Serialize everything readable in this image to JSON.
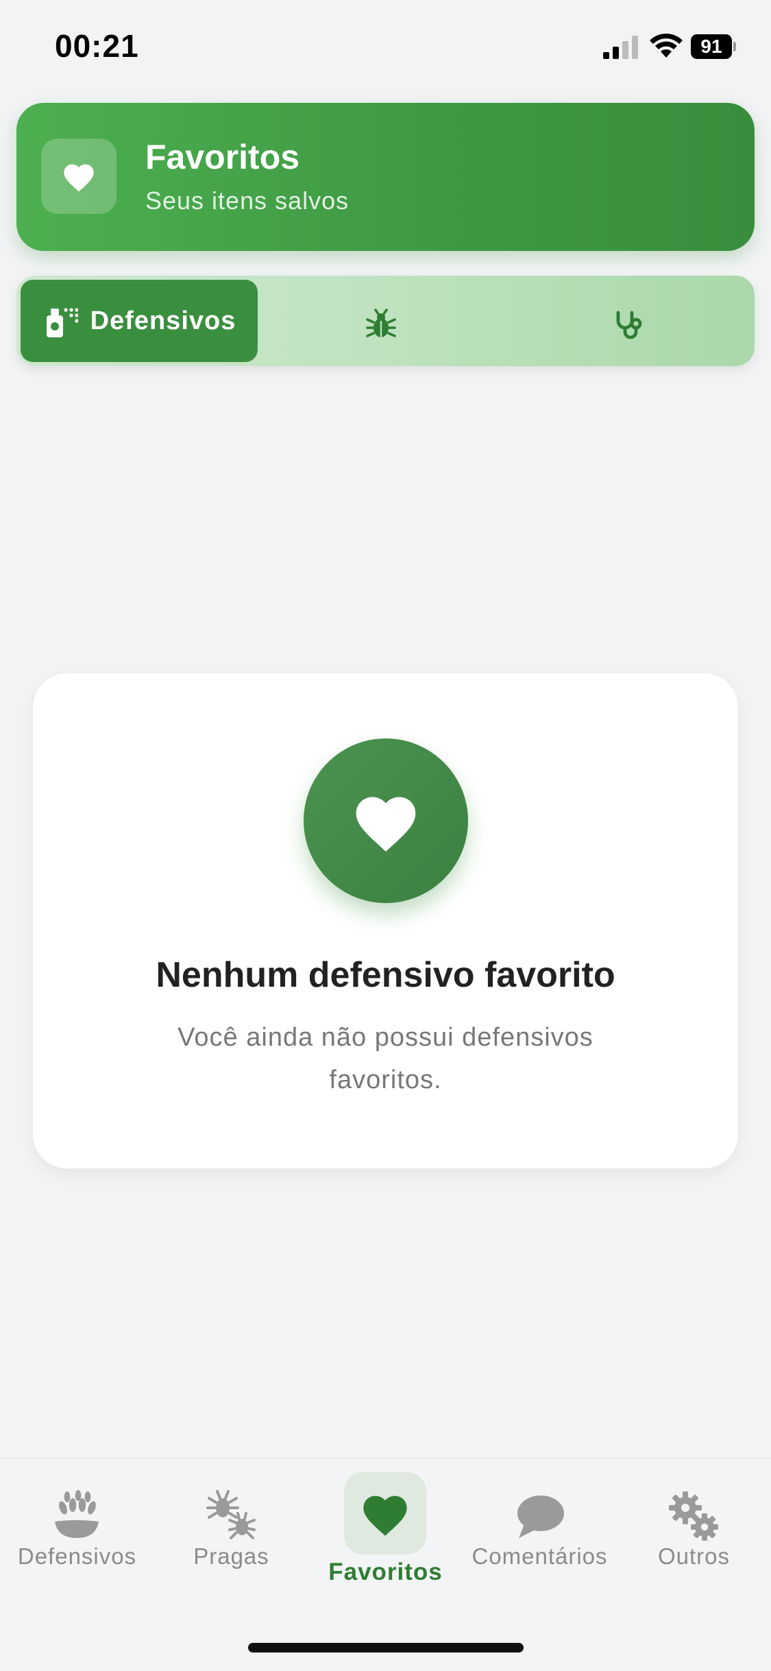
{
  "status_bar": {
    "time": "00:21",
    "battery": "91"
  },
  "header": {
    "title": "Favoritos",
    "subtitle": "Seus itens salvos",
    "icon": "heart-icon"
  },
  "tabs": [
    {
      "label": "Defensivos",
      "icon": "spray-bottle-icon",
      "active": true
    },
    {
      "label": "",
      "icon": "bug-icon",
      "active": false
    },
    {
      "label": "",
      "icon": "stethoscope-icon",
      "active": false
    }
  ],
  "empty_state": {
    "title": "Nenhum defensivo favorito",
    "description": "Você ainda não possui defensivos favoritos.",
    "icon": "heart-icon"
  },
  "bottom_nav": [
    {
      "label": "Defensivos",
      "icon": "grain-icon",
      "active": false
    },
    {
      "label": "Pragas",
      "icon": "pests-icon",
      "active": false
    },
    {
      "label": "Favoritos",
      "icon": "heart-icon",
      "active": true
    },
    {
      "label": "Comentários",
      "icon": "chat-bubble-icon",
      "active": false
    },
    {
      "label": "Outros",
      "icon": "gears-icon",
      "active": false
    }
  ],
  "colors": {
    "primary": "#388e3c",
    "primary_light": "#4caf50",
    "background": "#f2f3f5",
    "inactive": "#8a8a8a"
  }
}
